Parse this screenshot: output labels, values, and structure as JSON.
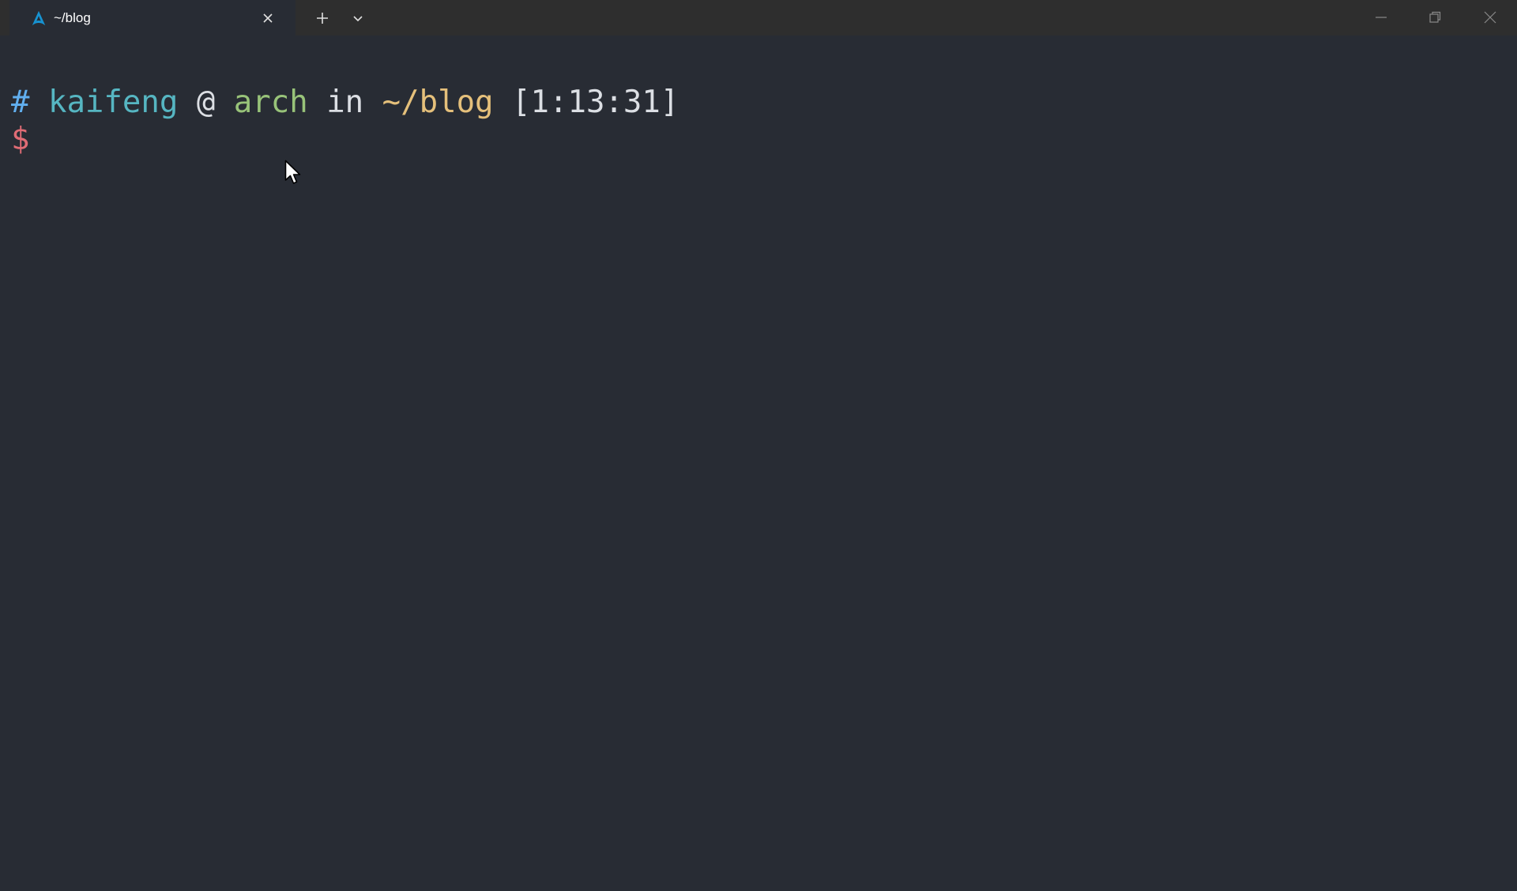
{
  "tab": {
    "title": "~/blog",
    "icon": "arch-linux-icon"
  },
  "colors": {
    "background": "#282c34",
    "titlebar": "#2e2e2e",
    "hash": "#61afef",
    "user": "#56b6c2",
    "at": "#dcdfe4",
    "host": "#98c379",
    "in": "#dcdfe4",
    "path": "#e5c07b",
    "time": "#dcdfe4",
    "dollar": "#e06c75",
    "arch_blue": "#1793d1"
  },
  "prompt": {
    "hash": "#",
    "user": "kaifeng",
    "at": "@",
    "host": "arch",
    "in": "in",
    "path": "~/blog",
    "time": "[1:13:31]",
    "dollar": "$"
  }
}
